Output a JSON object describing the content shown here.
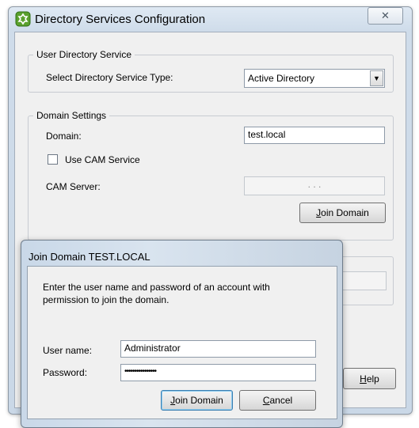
{
  "main_window": {
    "title": "Directory Services Configuration",
    "close_glyph": "✕",
    "user_directory_group": {
      "legend": "User Directory Service",
      "service_type_label": "Select Directory Service Type:",
      "service_type_value": "Active Directory"
    },
    "domain_group": {
      "legend": "Domain Settings",
      "domain_label": "Domain:",
      "domain_value": "test.local",
      "use_cam_label": "Use CAM Service",
      "use_cam_checked": false,
      "cam_server_label": "CAM Server:",
      "cam_server_value": ".       .       .",
      "join_button": {
        "mnemonic": "J",
        "rest": "oin Domain"
      }
    },
    "help_button": {
      "mnemonic": "H",
      "rest": "elp"
    }
  },
  "dialog": {
    "title": "Join Domain TEST.LOCAL",
    "instruction_line1": "Enter the user name and password of an account with",
    "instruction_line2": "permission to join the domain.",
    "username_label": "User name:",
    "username_value": "Administrator",
    "password_label": "Password:",
    "password_value": "••••••••••••••••",
    "join_button": {
      "mnemonic": "J",
      "rest": "oin Domain"
    },
    "cancel_button": {
      "mnemonic": "C",
      "rest": "ancel"
    }
  },
  "icons": {
    "app": "app-gear-icon",
    "dropdown": "chevron-down-icon",
    "close": "close-icon"
  },
  "colors": {
    "window_frame": "#cfdcea",
    "client_bg": "#f0f0f0",
    "default_button_border": "#3c7fb1"
  }
}
